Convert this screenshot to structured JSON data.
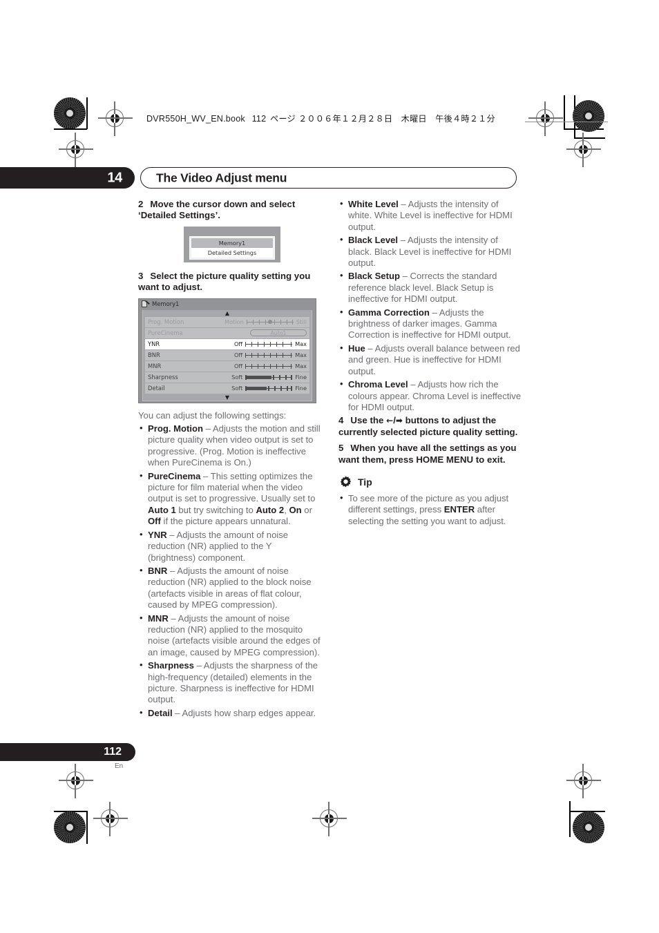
{
  "header": {
    "file_line_ascii": "DVR550H_WV_EN.book",
    "file_line_page": "112",
    "file_line_jp": "ページ ２００６年１２月２８日　木曜日　午後４時２１分"
  },
  "chapter": {
    "number": "14",
    "title": "The Video Adjust menu"
  },
  "left_column": {
    "step2": {
      "num": "2",
      "text": "Move the cursor down and select ‘Detailed Settings’."
    },
    "mini_dialog": {
      "selected_row": "Memory1",
      "second_row": "Detailed Settings"
    },
    "step3": {
      "num": "3",
      "text": "Select the picture quality setting you want to adjust."
    },
    "osd": {
      "title": "Memory1",
      "up_arrow": "▲",
      "down_arrow": "▼",
      "rows": [
        {
          "name": "Prog. Motion",
          "low": "Motion",
          "high": "Still",
          "type": "slider-knob",
          "state": "dim"
        },
        {
          "name": "PureCinema",
          "value": "Auto1",
          "type": "pill",
          "state": "dim"
        },
        {
          "name": "YNR",
          "low": "Off",
          "high": "Max",
          "type": "slider",
          "state": "highlight"
        },
        {
          "name": "BNR",
          "low": "Off",
          "high": "Max",
          "type": "slider",
          "state": "normal"
        },
        {
          "name": "MNR",
          "low": "Off",
          "high": "Max",
          "type": "slider",
          "state": "normal"
        },
        {
          "name": "Sharpness",
          "low": "Soft",
          "high": "Fine",
          "type": "slider-fill",
          "state": "normal"
        },
        {
          "name": "Detail",
          "low": "Soft",
          "high": "Fine",
          "type": "slider-fill",
          "state": "normal"
        }
      ]
    },
    "intro": "You can adjust the following settings:",
    "bullets": [
      {
        "term": "Prog. Motion",
        "dash": " – ",
        "desc": "Adjusts the motion and still picture quality when video output is set to progressive. (Prog. Motion is ineffective when PureCinema is On.)"
      },
      {
        "term": "PureCinema",
        "dash": " – ",
        "desc_pre": "This setting optimizes the picture for film material when the video output is set to progressive. Usually set to ",
        "b1": "Auto 1",
        "mid1": " but try switching to ",
        "b2": "Auto 2",
        "mid2": ", ",
        "b3": "On",
        "mid3": " or ",
        "b4": "Off",
        "desc_post": " if the picture appears unnatural."
      },
      {
        "term": "YNR",
        "dash": " – ",
        "desc": "Adjusts the amount of noise reduction (NR) applied to the Y (brightness) component."
      },
      {
        "term": "BNR",
        "dash": " – ",
        "desc": "Adjusts the amount of noise reduction (NR) applied to the block noise (artefacts visible in areas of flat colour, caused by MPEG compression)."
      },
      {
        "term": "MNR",
        "dash": " – ",
        "desc": "Adjusts the amount of noise reduction (NR) applied to the mosquito noise (artefacts visible around the edges of an image, caused by MPEG compression)."
      },
      {
        "term": "Sharpness",
        "dash": " – ",
        "desc": "Adjusts the sharpness of the high-frequency (detailed) elements in the picture. Sharpness is ineffective for HDMI output."
      },
      {
        "term": "Detail",
        "dash": " – ",
        "desc": "Adjusts how sharp edges appear."
      }
    ]
  },
  "right_column": {
    "bullets": [
      {
        "term": "White Level",
        "dash": " – ",
        "desc": "Adjusts the intensity of white. White Level is ineffective for HDMI output."
      },
      {
        "term": "Black Level",
        "dash": " – ",
        "desc": "Adjusts the intensity of black. Black Level is ineffective for HDMI output."
      },
      {
        "term": "Black Setup",
        "dash": " – ",
        "desc": "Corrects the standard reference black level. Black Setup is ineffective for HDMI output."
      },
      {
        "term": "Gamma Correction",
        "dash": " – ",
        "desc": "Adjusts the brightness of darker images. Gamma Correction is ineffective for HDMI output."
      },
      {
        "term": "Hue",
        "dash": " – ",
        "desc": "Adjusts overall balance between red and green. Hue is ineffective for HDMI output."
      },
      {
        "term": "Chroma Level",
        "dash": " – ",
        "desc": "Adjusts how rich the colours appear. Chroma Level is ineffective for HDMI output."
      }
    ],
    "step4": {
      "num": "4",
      "pre": "Use the ",
      "arrow_left": "←",
      "arrow_sep": "/",
      "arrow_right": "➡",
      "post": " buttons to adjust the currently selected picture quality setting."
    },
    "step5": {
      "num": "5",
      "text": "When you have all the settings as you want them, press HOME MENU to exit."
    },
    "tip": {
      "label": "Tip",
      "icon": "gear-icon",
      "bullet_pre": "To see more of the picture as you adjust different settings, press ",
      "bullet_bold": "ENTER",
      "bullet_post": " after selecting the setting you want to adjust."
    }
  },
  "footer": {
    "page_number": "112",
    "language": "En"
  }
}
